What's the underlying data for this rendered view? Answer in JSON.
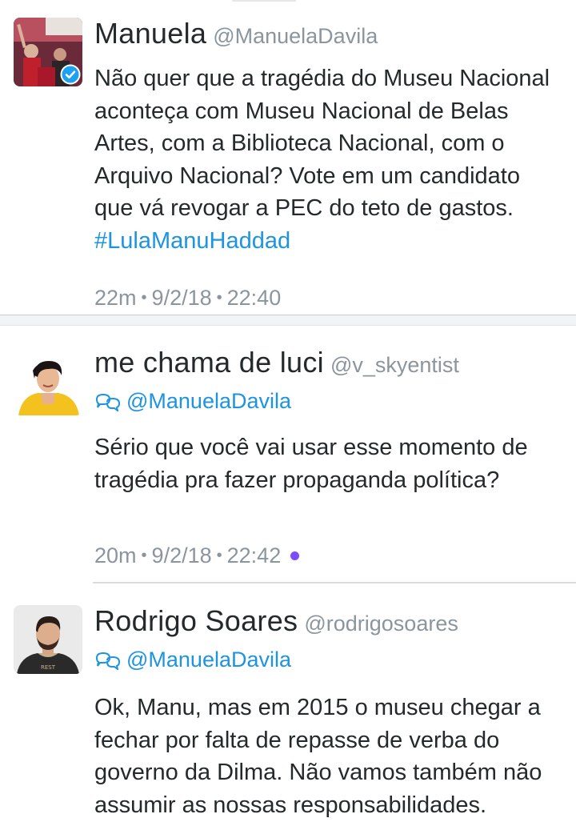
{
  "tweets": [
    {
      "name": "Manuela",
      "handle": "@ManuelaDavila",
      "verified": true,
      "text": "Não quer que a tragédia do Museu Nacional aconteça com Museu Nacional de Belas Artes, com a Biblioteca Nacional, com o Arquivo Nacional? Vote em um candidato que vá revogar a PEC do teto de gastos.",
      "hashtag": "#LulaManuHaddad",
      "relative_time": "22m",
      "date": "9/2/18",
      "time": "22:40"
    },
    {
      "name": "me chama de luci",
      "handle": "@v_skyentist",
      "reply_to": "@ManuelaDavila",
      "text": "Sério que você vai usar esse momento de tragédia pra fazer propaganda política?",
      "relative_time": "20m",
      "date": "9/2/18",
      "time": "22:42",
      "unread": true
    },
    {
      "name": "Rodrigo Soares",
      "handle": "@rodrigosoares",
      "reply_to": "@ManuelaDavila",
      "text": "Ok, Manu, mas em 2015 o museu chegar a fechar por falta de repasse de verba do governo da Dilma. Não vamos também não assumir as nossas responsabilidades."
    }
  ],
  "meta_separator": "•",
  "colors": {
    "link": "#1c94e0",
    "muted": "#8a959e",
    "unread_dot": "#7b4dff",
    "verified": "#1da1f2"
  },
  "icons": {
    "verified": "verified-badge-icon",
    "reply": "conversation-icon"
  }
}
